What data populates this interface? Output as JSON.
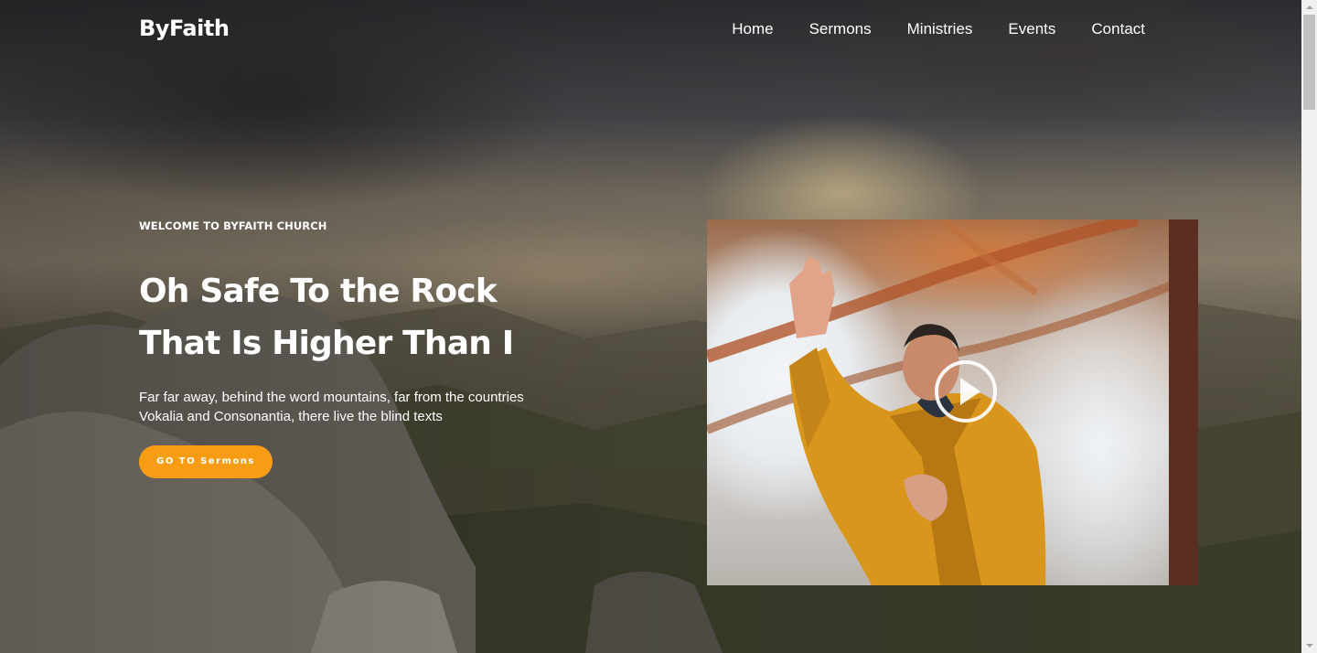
{
  "brand": {
    "name": "ByFaith"
  },
  "nav": {
    "items": [
      {
        "label": "Home"
      },
      {
        "label": "Sermons"
      },
      {
        "label": "Ministries"
      },
      {
        "label": "Events"
      },
      {
        "label": "Contact"
      }
    ]
  },
  "hero": {
    "kicker": "WELCOME TO BYFAITH CHURCH",
    "headline_line1": "Oh Safe To the Rock",
    "headline_line2": "That Is Higher Than I",
    "description_line1": "Far far away, behind the word mountains, far from the countries",
    "description_line2": "Vokalia and Consonantia, there live the blind texts",
    "cta_label": "GO TO Sermons"
  },
  "video": {
    "play_icon": "play-icon"
  },
  "colors": {
    "accent": "#f89d13",
    "text": "#ffffff"
  }
}
